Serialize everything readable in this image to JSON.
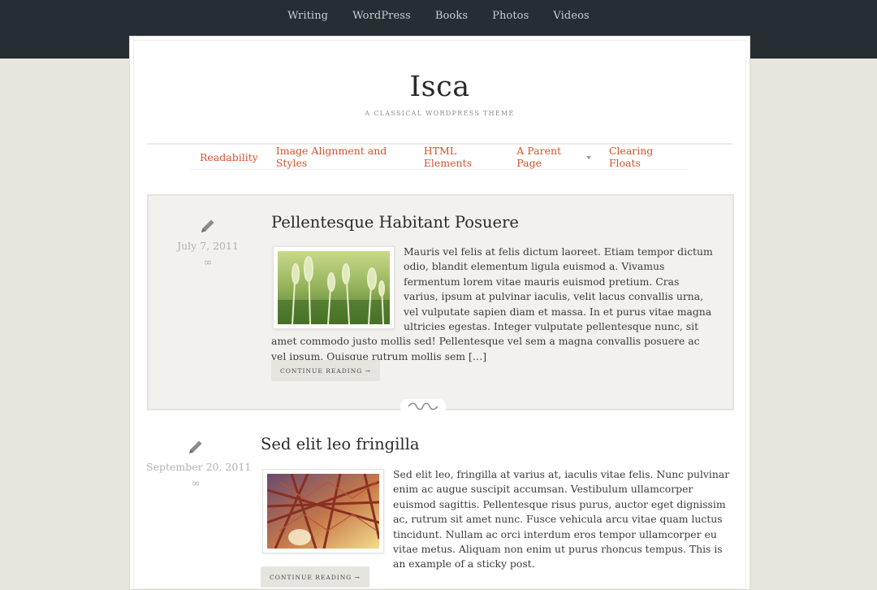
{
  "topnav": {
    "items": [
      "Writing",
      "WordPress",
      "Books",
      "Photos",
      "Videos"
    ]
  },
  "site": {
    "title": "Isca",
    "description": "A CLASSICAL WORDPRESS THEME"
  },
  "mainnav": {
    "items": [
      "Readability",
      "Image Alignment and Styles",
      "HTML Elements",
      "A Parent Page",
      "Clearing Floats"
    ]
  },
  "posts": [
    {
      "title": "Pellentesque Habitant Posuere",
      "date": "July 7, 2011",
      "permalink": "∞",
      "excerpt": "Mauris vel felis at felis dictum laoreet. Etiam tempor dictum odio, blandit elementum ligula euismod a. Vivamus fermentum lorem vitae mauris euismod pretium. Cras varius, ipsum at pulvinar iaculis, velit lacus convallis urna, vel vulputate sapien diam et massa. In et purus vitae magna ultricies egestas. Integer vulputate pellentesque nunc, sit amet commodo justo mollis sed! Pellentesque vel sem a magna convallis posuere ac vel ipsum. Quisque rutrum mollis sem […]",
      "button": "CONTINUE READING →",
      "icon": "pencil-icon",
      "image": "wheat-field-thumbnail"
    },
    {
      "title": "Sed elit leo fringilla",
      "date": "September 20, 2011",
      "permalink": "∞",
      "excerpt": "Sed elit leo, fringilla at varius at, iaculis vitae felis. Nunc pulvinar enim ac augue suscipit accumsan. Vestibulum ullamcorper euismod sagittis. Pellentesque risus purus, auctor eget dignissim ac, rutrum sit amet nunc. Fusce vehicula arcu vitae quam luctus tincidunt. Nullam ac orci interdum eros tempor ullamcorper eu vitae metus. Aliquam non enim ut purus rhoncus tempus. This is an example of a sticky post.",
      "button": "CONTINUE READING →",
      "icon": "pencil-icon",
      "image": "steel-structure-thumbnail"
    }
  ],
  "colors": {
    "topbar": "#262e33",
    "accent": "#d4512b",
    "background": "#e8e5de",
    "sticky_post_bg": "#f2f1ee"
  }
}
